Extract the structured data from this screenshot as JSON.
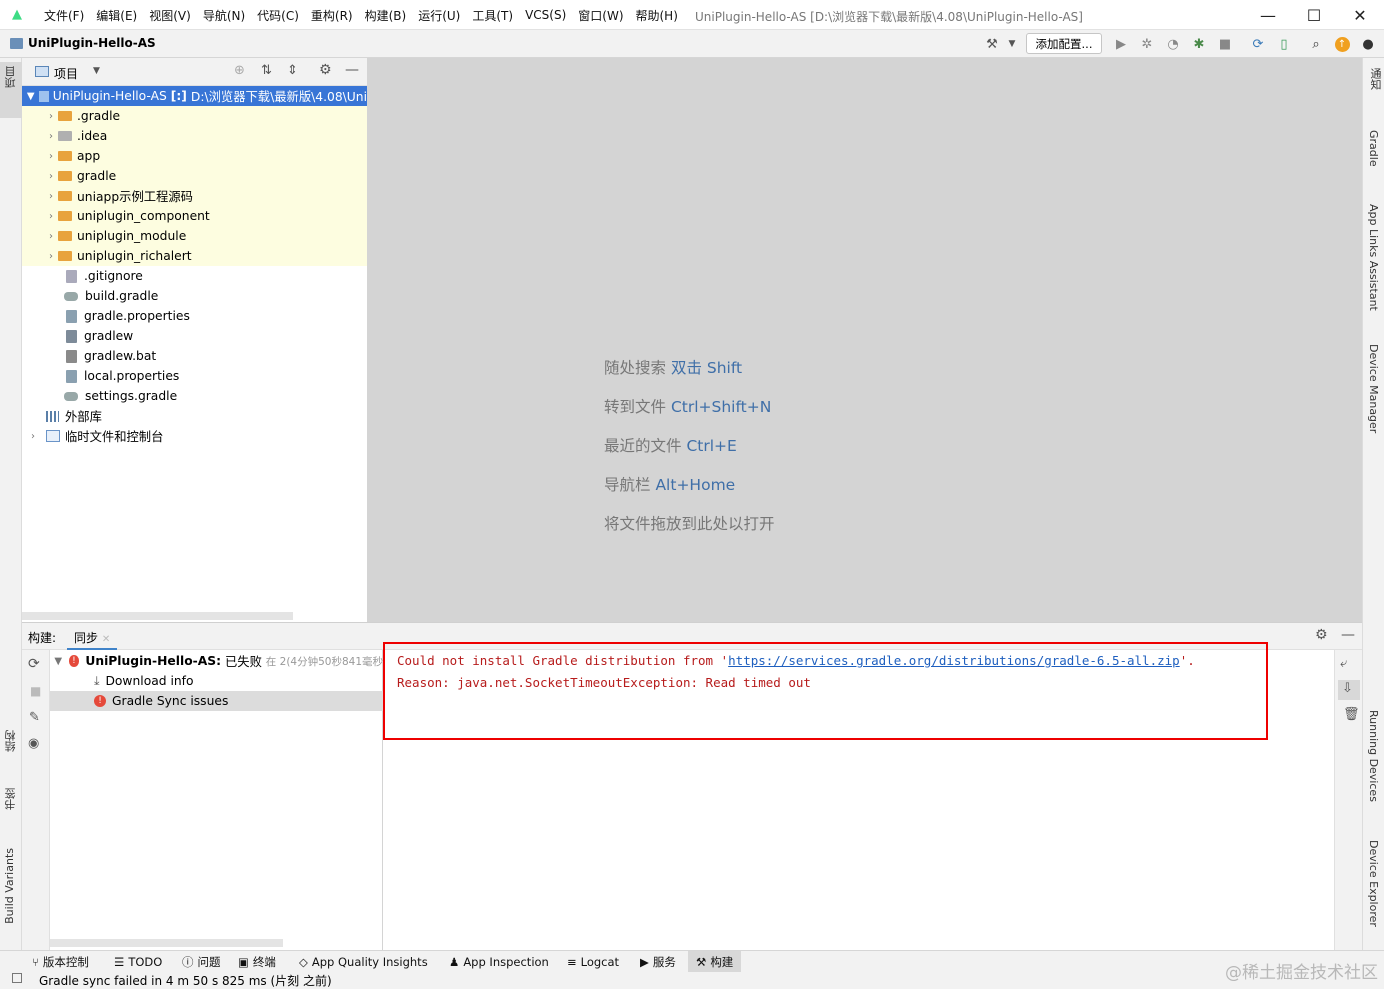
{
  "menubar": {
    "items": [
      "文件(F)",
      "编辑(E)",
      "视图(V)",
      "导航(N)",
      "代码(C)",
      "重构(R)",
      "构建(B)",
      "运行(U)",
      "工具(T)",
      "VCS(S)",
      "窗口(W)",
      "帮助(H)"
    ],
    "window_title": "UniPlugin-Hello-AS [D:\\浏览器下载\\最新版\\4.08\\UniPlugin-Hello-AS]"
  },
  "navbar": {
    "project": "UniPlugin-Hello-AS",
    "add_config": "添加配置..."
  },
  "left_strip": {
    "project_tab": "项目",
    "structure_tab": "结构",
    "bookmarks_tab": "书签",
    "build_variants_tab": "Build Variants"
  },
  "right_strip": {
    "notifications": "通知",
    "gradle": "Gradle",
    "app_links": "App Links Assistant",
    "device_manager": "Device Manager",
    "running_devices": "Running Devices",
    "device_explorer": "Device Explorer"
  },
  "project_panel": {
    "title": "项目",
    "root": {
      "name": "UniPlugin-Hello-AS",
      "tag": "[:]",
      "path": "D:\\浏览器下载\\最新版\\4.08\\Uni"
    },
    "folders": [
      ".gradle",
      ".idea",
      "app",
      "gradle",
      "uniapp示例工程源码",
      "uniplugin_component",
      "uniplugin_module",
      "uniplugin_richalert"
    ],
    "files": [
      ".gitignore",
      "build.gradle",
      "gradle.properties",
      "gradlew",
      "gradlew.bat",
      "local.properties",
      "settings.gradle"
    ],
    "external_libs": "外部库",
    "scratches": "临时文件和控制台"
  },
  "editor_hints": [
    {
      "label": "随处搜索",
      "key": "双击 Shift"
    },
    {
      "label": "转到文件",
      "key": "Ctrl+Shift+N"
    },
    {
      "label": "最近的文件",
      "key": "Ctrl+E"
    },
    {
      "label": "导航栏",
      "key": "Alt+Home"
    },
    {
      "label": "将文件拖放到此处以打开",
      "key": ""
    }
  ],
  "build_panel": {
    "label": "构建:",
    "tab": "同步",
    "tree": {
      "root_name": "UniPlugin-Hello-AS:",
      "root_status": "已失败",
      "root_time": "在 2(4分钟50秒841毫秒",
      "download": "Download info",
      "issues": "Gradle Sync issues"
    },
    "console": {
      "line1_pre": "Could not install Gradle distribution from '",
      "line1_link": "https://services.gradle.org/distributions/gradle-6.5-all.zip",
      "line1_post": "'.",
      "line2": "Reason: java.net.SocketTimeoutException: Read timed out"
    }
  },
  "bottom_tabs": [
    "版本控制",
    "TODO",
    "问题",
    "终端",
    "App Quality Insights",
    "App Inspection",
    "Logcat",
    "服务",
    "构建"
  ],
  "status": "Gradle sync failed in 4 m 50 s 825 ms (片刻 之前)",
  "watermark": "@稀土掘金技术社区",
  "colors": {
    "selection": "#3875d6",
    "error": "#e5493a",
    "link": "#1e5fbf",
    "highlight_box": "#ee0000"
  }
}
